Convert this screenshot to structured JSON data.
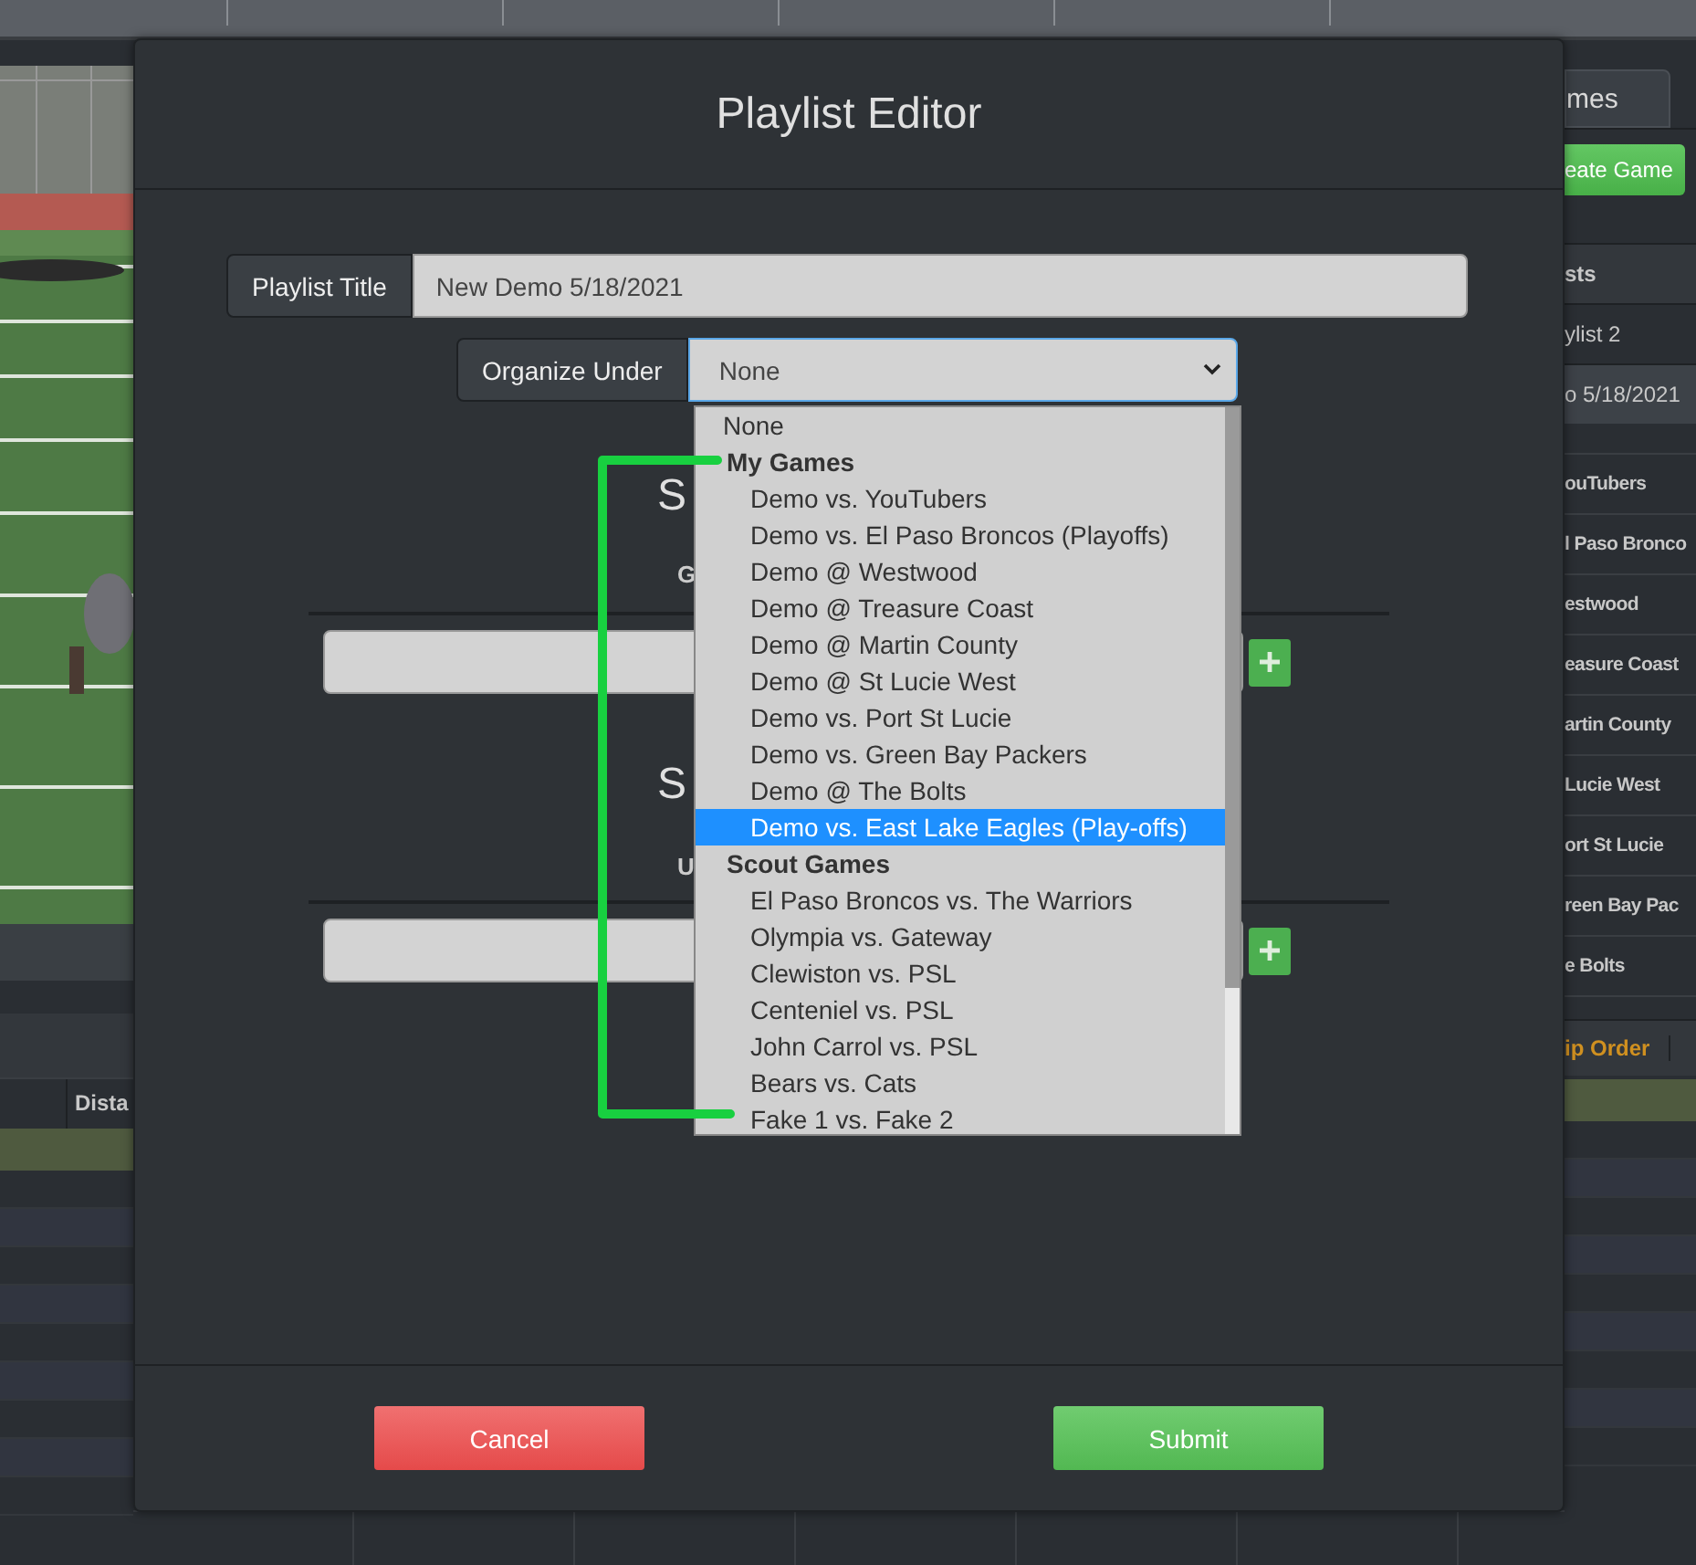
{
  "background": {
    "tab": {
      "label": "mes",
      "selected": true
    },
    "create_button": "eate Game",
    "list_header": "sts",
    "playlists": [
      {
        "label": "ylist 2",
        "selected": false
      },
      {
        "label": "o 5/18/2021",
        "selected": true
      }
    ],
    "games": [
      "ouTubers",
      "l Paso Bronco",
      "estwood",
      "easure Coast",
      "artin County",
      "Lucie West",
      "ort St Lucie",
      "reen Bay Pac",
      "e Bolts"
    ],
    "order_button": "ip Order",
    "table_header": "Dista"
  },
  "modal": {
    "title": "Playlist Editor",
    "playlist_title": {
      "label": "Playlist Title",
      "value": "New Demo 5/18/2021"
    },
    "organize_under": {
      "label": "Organize Under",
      "value": "None"
    },
    "sections": [
      {
        "heading": "S",
        "subheading": "G"
      },
      {
        "heading": "S",
        "subheading": "U"
      }
    ],
    "buttons": [
      {
        "label": "Cancel",
        "kind": "cancel"
      },
      {
        "label": "Submit",
        "kind": "submit"
      }
    ]
  },
  "dropdown": {
    "options": [
      {
        "label": "None",
        "kind": "option",
        "selected": false
      },
      {
        "label": "My Games",
        "kind": "group",
        "selected": false
      },
      {
        "label": "Demo vs. YouTubers",
        "kind": "item",
        "selected": false
      },
      {
        "label": "Demo vs. El Paso Broncos (Playoffs)",
        "kind": "item",
        "selected": false
      },
      {
        "label": "Demo @ Westwood",
        "kind": "item",
        "selected": false
      },
      {
        "label": "Demo @ Treasure Coast",
        "kind": "item",
        "selected": false
      },
      {
        "label": "Demo @ Martin County",
        "kind": "item",
        "selected": false
      },
      {
        "label": "Demo @ St Lucie West",
        "kind": "item",
        "selected": false
      },
      {
        "label": "Demo vs. Port St Lucie",
        "kind": "item",
        "selected": false
      },
      {
        "label": "Demo vs. Green Bay Packers",
        "kind": "item",
        "selected": false
      },
      {
        "label": "Demo @ The Bolts",
        "kind": "item",
        "selected": false
      },
      {
        "label": "Demo vs. East Lake Eagles (Play-offs)",
        "kind": "item",
        "selected": true
      },
      {
        "label": "Scout Games",
        "kind": "group",
        "selected": false
      },
      {
        "label": "El Paso Broncos vs. The Warriors",
        "kind": "item",
        "selected": false
      },
      {
        "label": "Olympia vs. Gateway",
        "kind": "item",
        "selected": false
      },
      {
        "label": "Clewiston vs. PSL",
        "kind": "item",
        "selected": false
      },
      {
        "label": "Centeniel vs. PSL",
        "kind": "item",
        "selected": false
      },
      {
        "label": "John Carrol vs. PSL",
        "kind": "item",
        "selected": false
      },
      {
        "label": "Bears vs. Cats",
        "kind": "item",
        "selected": false
      },
      {
        "label": "Fake 1 vs. Fake 2",
        "kind": "item",
        "selected": false
      }
    ]
  }
}
